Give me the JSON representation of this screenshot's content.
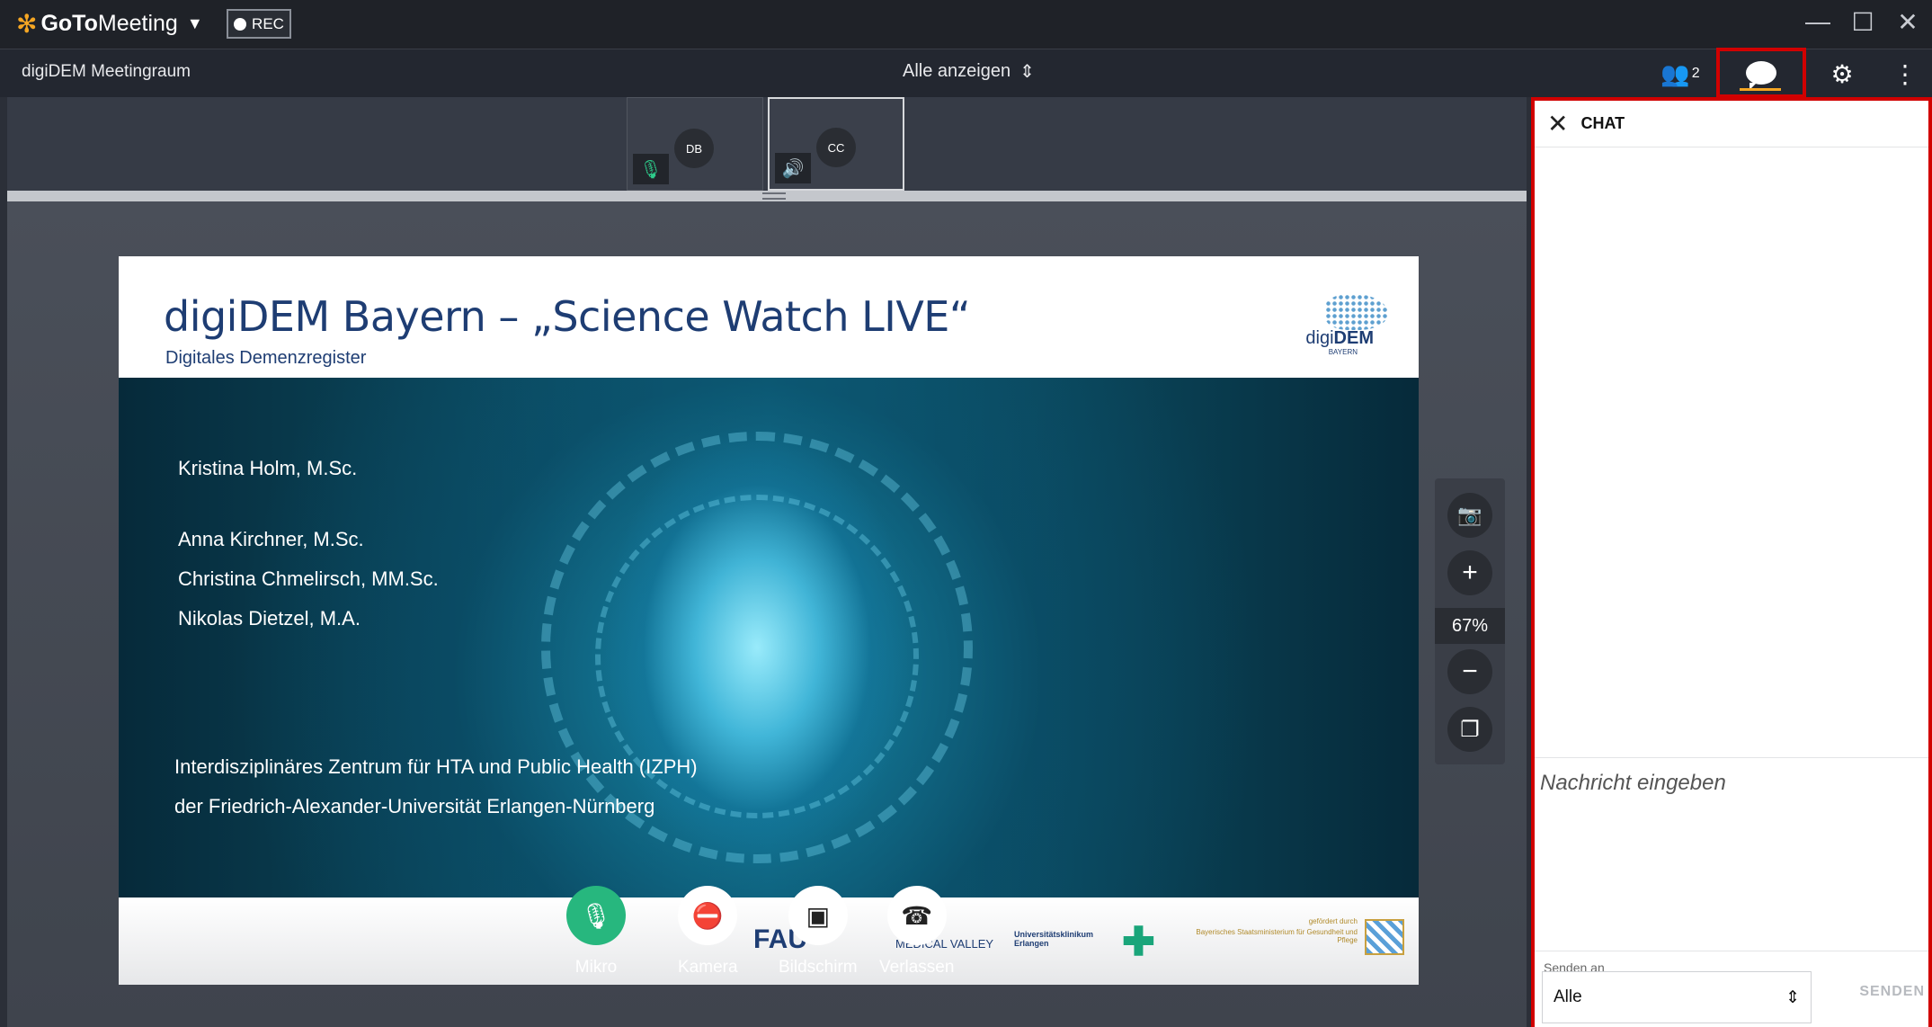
{
  "app": {
    "brand_bold": "GoTo",
    "brand_rest": "Meeting",
    "rec_label": "REC"
  },
  "meeting": {
    "name": "digiDEM Meetingraum",
    "view_selector": "Alle anzeigen",
    "participant_count": "2"
  },
  "participants": [
    {
      "initials": "DB"
    },
    {
      "initials": "CC"
    }
  ],
  "slide": {
    "title": "digiDEM Bayern – „Science Watch LIVE“",
    "subtitle": "Digitales Demenzregister",
    "logo_text_light": "digi",
    "logo_text_bold": "DEM",
    "logo_sub": "BAYERN",
    "presenters": [
      "Kristina Holm, M.Sc.",
      "Anna Kirchner, M.Sc.",
      "Christina Chmelirsch, MM.Sc.",
      "Nikolas Dietzel, M.A."
    ],
    "institute_line1": "Interdisziplinäres Zentrum für HTA und Public Health (IZPH)",
    "institute_line2": "der Friedrich-Alexander-Universität Erlangen-Nürnberg",
    "footer_logos": {
      "fau": "FAU",
      "medical_valley": "MEDICAL VALLEY",
      "uk_erlangen": "Universitätsklinikum Erlangen",
      "funded_by": "gefördert durch",
      "ministry": "Bayerisches Staatsministerium für Gesundheit und Pflege"
    }
  },
  "zoom": {
    "level": "67%"
  },
  "controls": {
    "mic": "Mikro",
    "camera": "Kamera",
    "screen": "Bildschirm",
    "leave": "Verlassen"
  },
  "chat": {
    "title": "CHAT",
    "input_placeholder": "Nachricht eingeben",
    "send_to_label": "Senden an",
    "send_to_value": "Alle",
    "send_button": "SENDEN"
  },
  "colors": {
    "accent_orange": "#f5a623",
    "highlight_red": "#d10000",
    "mic_green": "#27b77e",
    "slide_blue": "#1e3d73"
  }
}
